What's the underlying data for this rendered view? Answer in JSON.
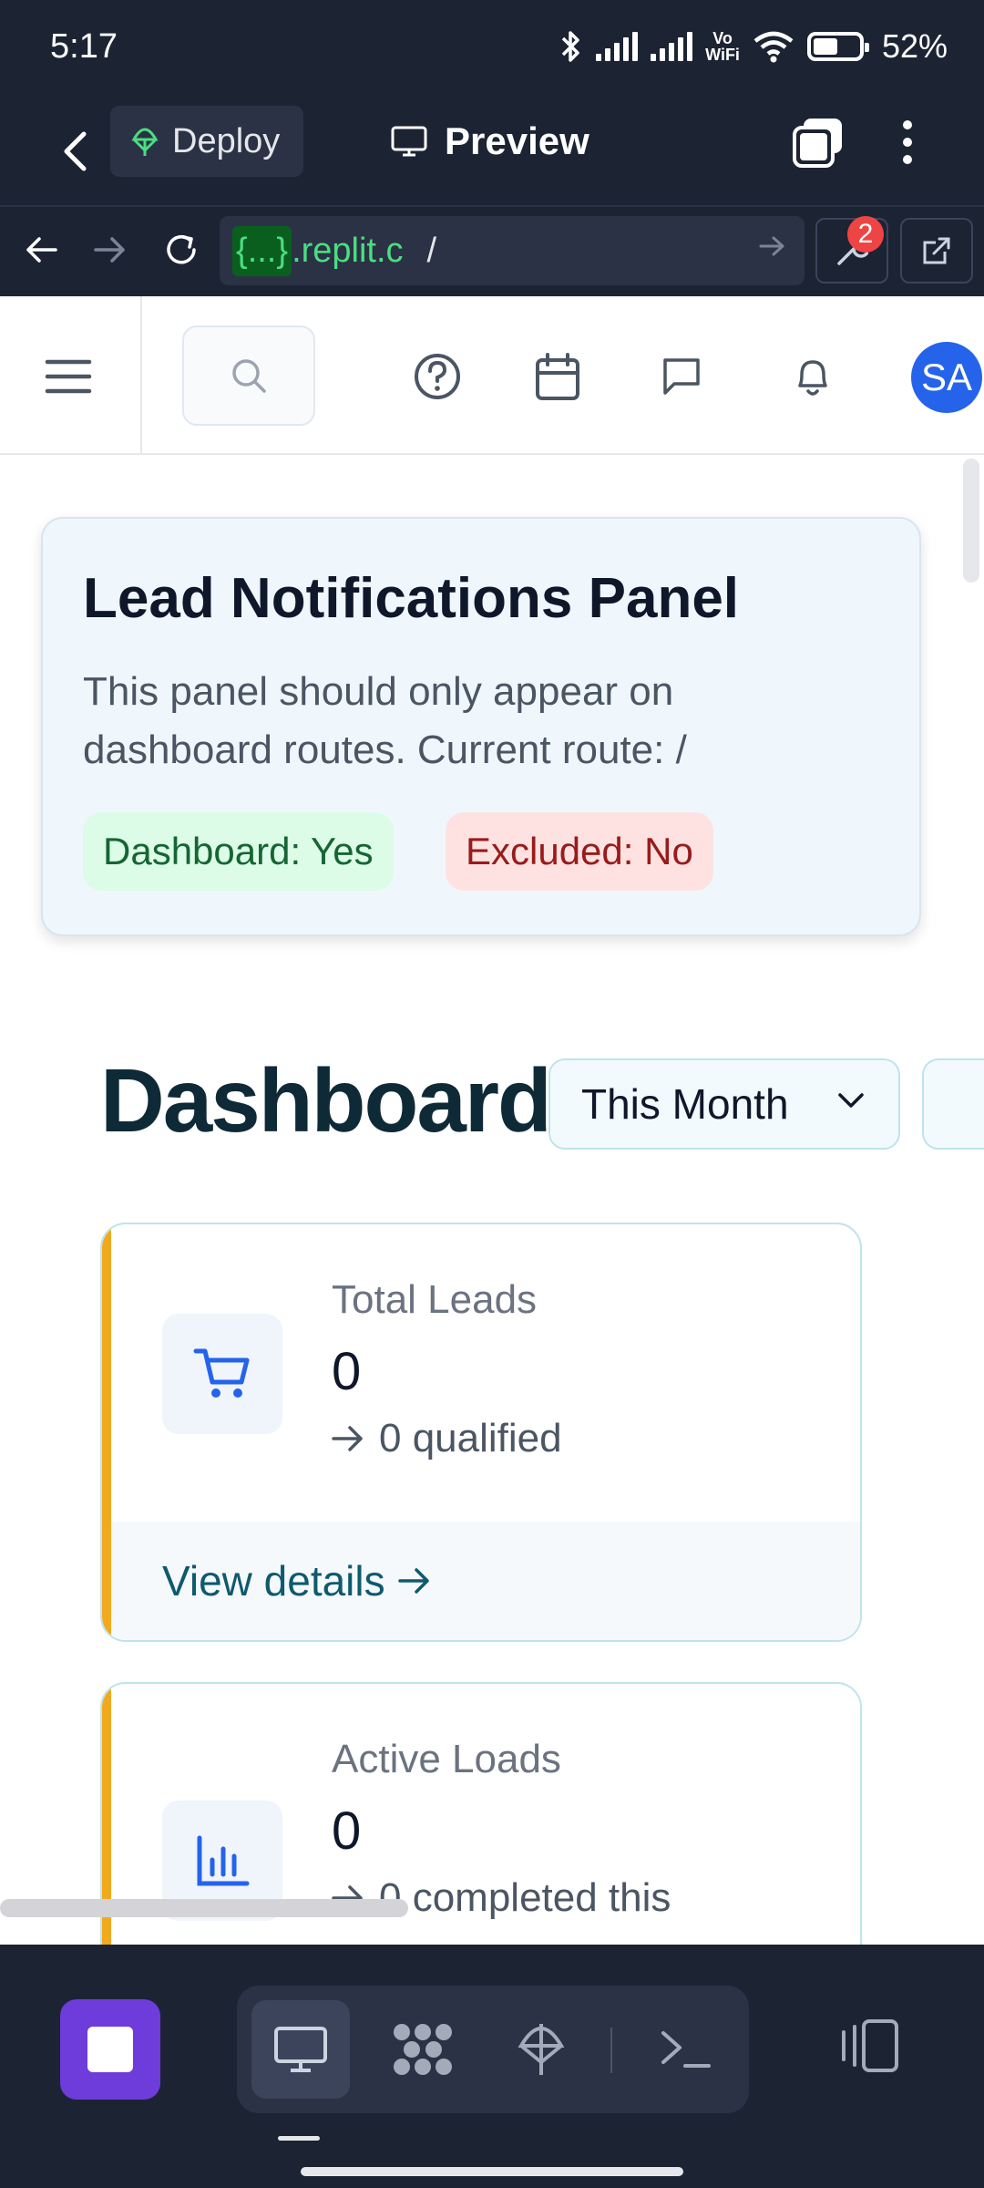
{
  "status_bar": {
    "time": "5:17",
    "network_label_1": "Vo",
    "network_label_2": "WiFi",
    "battery": "52%"
  },
  "replit_header": {
    "deploy_label": "Deploy",
    "preview_label": "Preview"
  },
  "url_bar": {
    "host_placeholder": "{...}",
    "domain": ".replit.c",
    "path": "/",
    "devtools_badge": "2"
  },
  "app": {
    "avatar_initials": "SA",
    "lead_panel": {
      "title": "Lead Notifications Panel",
      "description": "This panel should only appear on dashboard routes. Current route: /",
      "dashboard_pill": "Dashboard: Yes",
      "excluded_pill": "Excluded: No"
    },
    "dashboard": {
      "title": "Dashboard",
      "period_select": "This Month"
    },
    "cards": [
      {
        "label": "Total Leads",
        "value": "0",
        "sub": "0 qualified",
        "footer": "View details",
        "icon": "cart-icon"
      },
      {
        "label": "Active Loads",
        "value": "0",
        "sub": "0 completed this",
        "icon": "bar-chart-icon"
      }
    ]
  },
  "colors": {
    "accent": "#f2a91e",
    "avatar": "#2563eb",
    "replit_bg": "#1c2333",
    "replit_logo": "#6e3cdb",
    "success_bg": "#dcfce7",
    "danger_bg": "#fee2e2"
  }
}
